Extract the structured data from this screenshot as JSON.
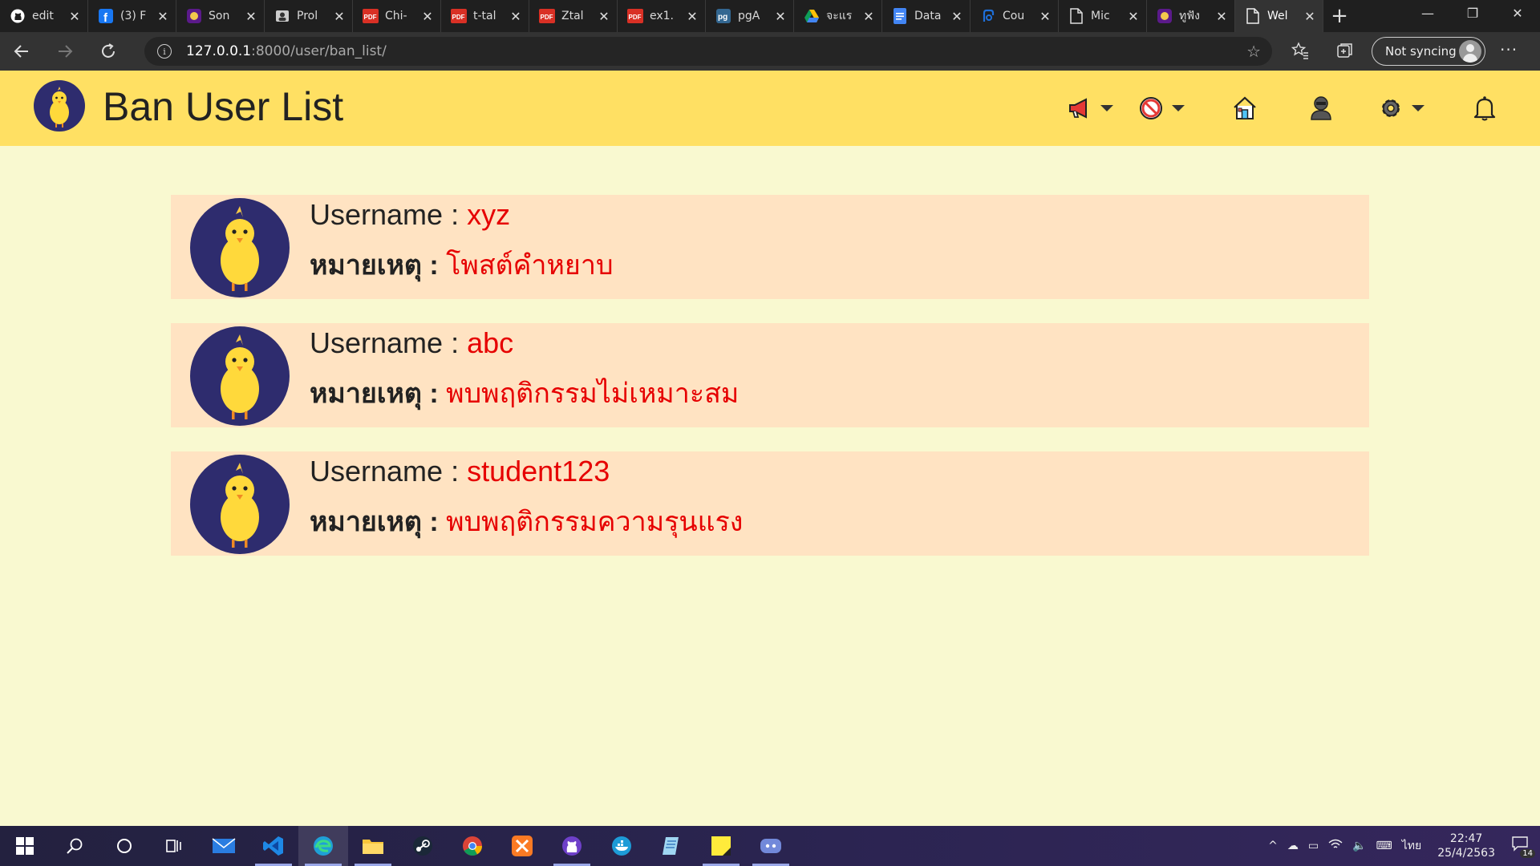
{
  "browser": {
    "tabs": [
      {
        "title": "edit",
        "icon": "github-icon"
      },
      {
        "title": "(3) F",
        "icon": "facebook-icon"
      },
      {
        "title": "Son",
        "icon": "purple-app-icon"
      },
      {
        "title": "Prol",
        "icon": "profile-icon"
      },
      {
        "title": "Chi-",
        "icon": "pdf-icon"
      },
      {
        "title": "t-tal",
        "icon": "pdf-icon"
      },
      {
        "title": "Ztal",
        "icon": "pdf-icon"
      },
      {
        "title": "ex1.",
        "icon": "pdf-icon"
      },
      {
        "title": "pgA",
        "icon": "pgadmin-icon"
      },
      {
        "title": "จะแร",
        "icon": "google-drive-icon"
      },
      {
        "title": "Data",
        "icon": "google-docs-icon"
      },
      {
        "title": "Cou",
        "icon": "coursera-icon"
      },
      {
        "title": "Mic",
        "icon": "page-icon"
      },
      {
        "title": "ทูฟัง",
        "icon": "purple-app-icon"
      },
      {
        "title": "Wel",
        "icon": "page-icon",
        "active": true
      }
    ],
    "url_host": "127.0.0.1",
    "url_path": ":8000/user/ban_list/",
    "sync_label": "Not syncing"
  },
  "header": {
    "title": "Ban User List",
    "accent_color": "#ffe063",
    "icons": [
      "megaphone-icon",
      "ban-icon",
      "home-icon",
      "user-icon",
      "gear-icon",
      "bell-icon"
    ]
  },
  "page": {
    "background": "#f9f9d0",
    "card_background": "#ffe3c2",
    "value_color": "#e60000"
  },
  "ban_list": [
    {
      "username_label": "Username : ",
      "username": "xyz",
      "note_label": "หมายเหตุ : ",
      "note": "โพสต์คำหยาบ"
    },
    {
      "username_label": "Username : ",
      "username": "abc",
      "note_label": "หมายเหตุ : ",
      "note": "พบพฤติกรรมไม่เหมาะสม"
    },
    {
      "username_label": "Username : ",
      "username": "student123",
      "note_label": "หมายเหตุ : ",
      "note": "พบพฤติกรรมความรุนแรง"
    }
  ],
  "taskbar": {
    "apps": [
      "windows-start-icon",
      "search-icon",
      "cortana-icon",
      "task-view-icon",
      "mail-icon",
      "vscode-icon",
      "edge-icon",
      "file-explorer-icon",
      "steam-icon",
      "chrome-icon",
      "xampp-icon",
      "github-desktop-icon",
      "docker-icon",
      "notepad-icon",
      "sticky-notes-icon",
      "discord-icon"
    ],
    "language": "ไทย",
    "time": "22:47",
    "date": "25/4/2563",
    "notification_count": "14"
  }
}
